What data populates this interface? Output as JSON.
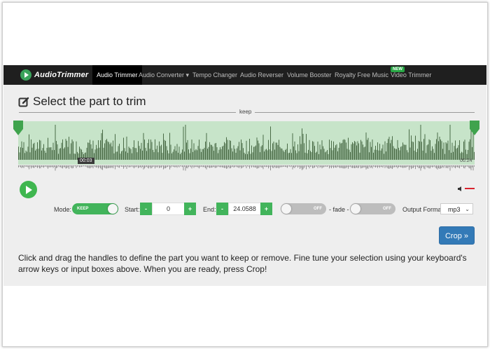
{
  "nav": {
    "logo_text": "AudioTrimmer",
    "items": [
      {
        "label": "Audio Trimmer",
        "active": true
      },
      {
        "label": "Audio Converter ▾",
        "active": false
      },
      {
        "label": "Tempo Changer",
        "active": false
      },
      {
        "label": "Audio Reverser",
        "active": false
      },
      {
        "label": "Volume Booster",
        "active": false
      },
      {
        "label": "Royalty Free Music",
        "active": false
      },
      {
        "label": "Video Trimmer",
        "active": false
      }
    ],
    "new_badge": "NEW"
  },
  "page": {
    "title": "Select the part to trim",
    "keep_label": "keep"
  },
  "waveform": {
    "current_time": "00:03",
    "end_time": "00:24",
    "selection_color": "#c7e4c9",
    "wave_color": "#4a6b46",
    "handle_color": "#3fa34d"
  },
  "controls": {
    "mode_label": "Mode:",
    "mode_value": "KEEP",
    "start_label": "Start:",
    "start_value": "0",
    "end_label": "End:",
    "end_value": "24.0588",
    "minus": "-",
    "plus": "+",
    "fade_in": "OFF",
    "fade_label": "- fade -",
    "fade_out": "OFF",
    "output_format_label": "Output Format",
    "output_format_value": "mp3",
    "crop_label": "Crop »"
  },
  "instructions": "Click and drag the handles to define the part you want to keep or remove. Fine tune your selection using your keyboard's arrow keys or input boxes above. When you are ready, press Crop!"
}
